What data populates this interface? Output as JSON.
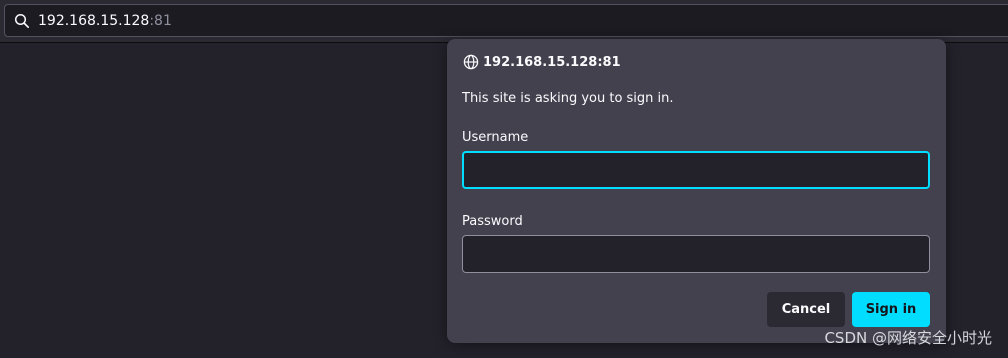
{
  "urlbar": {
    "host": "192.168.15.128",
    "port": ":81",
    "icon": "search-icon"
  },
  "dialog": {
    "host": "192.168.15.128:81",
    "icon": "globe-icon",
    "message": "This site is asking you to sign in.",
    "username_label": "Username",
    "username_value": "",
    "password_label": "Password",
    "password_value": "",
    "cancel_label": "Cancel",
    "signin_label": "Sign in",
    "accent_color": "#00ddff"
  },
  "watermark": "CSDN @网络安全小时光"
}
